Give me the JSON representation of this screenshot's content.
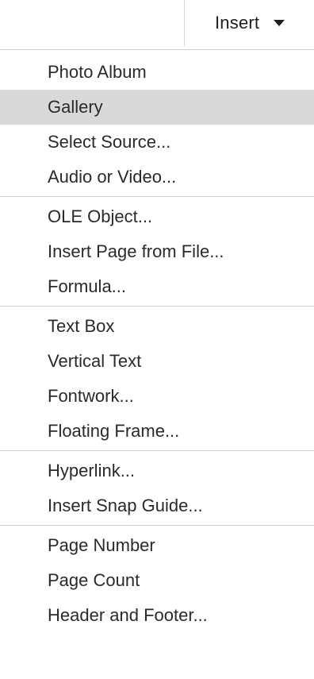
{
  "toolbar": {
    "insert_label": "Insert",
    "caret_icon": "chevron-down-icon"
  },
  "menu": {
    "groups": [
      [
        {
          "label": "Photo Album",
          "highlighted": false
        },
        {
          "label": "Gallery",
          "highlighted": true
        },
        {
          "label": "Select Source...",
          "highlighted": false
        },
        {
          "label": "Audio or Video...",
          "highlighted": false
        }
      ],
      [
        {
          "label": "OLE Object...",
          "highlighted": false
        },
        {
          "label": "Insert Page from File...",
          "highlighted": false
        },
        {
          "label": "Formula...",
          "highlighted": false
        }
      ],
      [
        {
          "label": "Text Box",
          "highlighted": false
        },
        {
          "label": "Vertical Text",
          "highlighted": false
        },
        {
          "label": "Fontwork...",
          "highlighted": false
        },
        {
          "label": "Floating Frame...",
          "highlighted": false
        }
      ],
      [
        {
          "label": "Hyperlink...",
          "highlighted": false
        },
        {
          "label": "Insert Snap Guide...",
          "highlighted": false
        }
      ],
      [
        {
          "label": "Page Number",
          "highlighted": false
        },
        {
          "label": "Page Count",
          "highlighted": false
        },
        {
          "label": "Header and Footer...",
          "highlighted": false
        }
      ]
    ]
  },
  "colors": {
    "highlight": "#d9d9d9",
    "separator": "#d3d3d3",
    "text": "#2a2a2a"
  }
}
